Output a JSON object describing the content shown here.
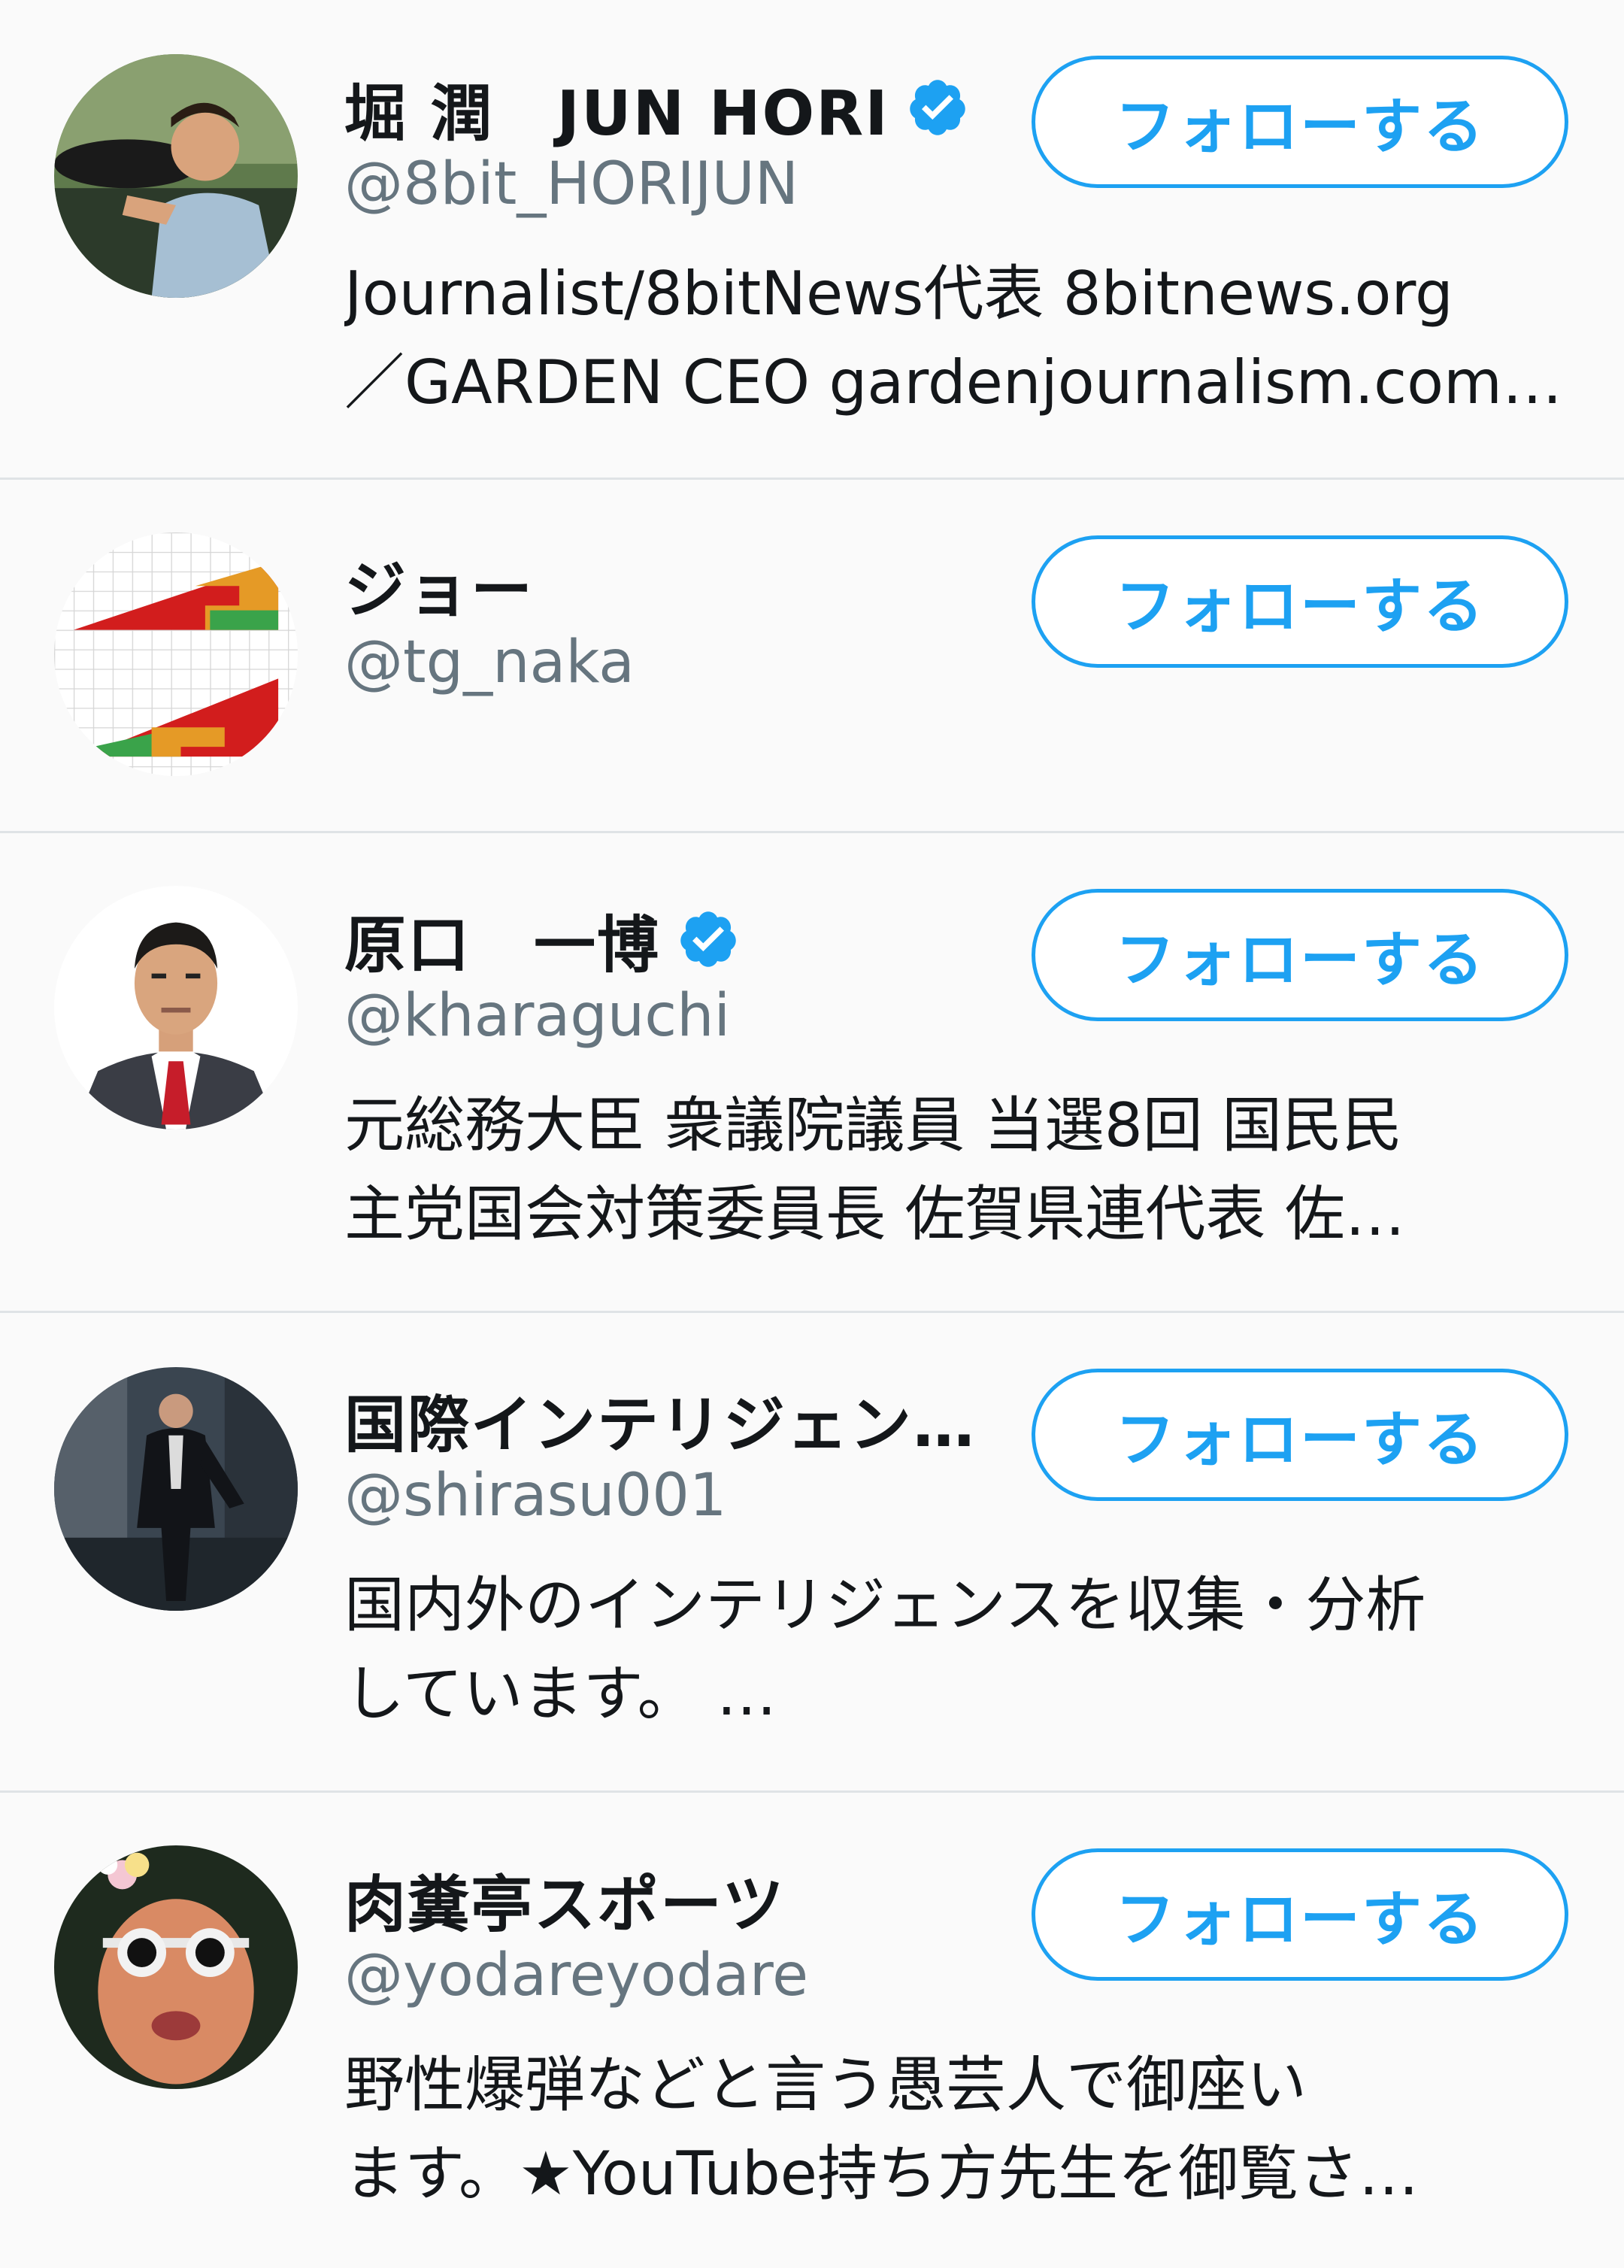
{
  "accent_color": "#1da1f2",
  "users": [
    {
      "name": "堀 潤　JUN HORI",
      "verified": true,
      "handle": "@8bit_HORIJUN",
      "bio_lines": [
        "Journalist/8bitNews代表 8bitnews.org",
        "／GARDEN CEO gardenjournalism.com…"
      ],
      "follow_label": "フォローする"
    },
    {
      "name": "ジョー",
      "verified": false,
      "handle": "@tg_naka",
      "bio_lines": [],
      "follow_label": "フォローする"
    },
    {
      "name": "原口　一博",
      "verified": true,
      "handle": "@kharaguchi",
      "bio_lines": [
        "元総務大臣 衆議院議員 当選8回 国民民",
        "主党国会対策委員長 佐賀県連代表 佐…"
      ],
      "follow_label": "フォローする"
    },
    {
      "name": "国際インテリジェン…",
      "verified": false,
      "handle": "@shirasu001",
      "bio_lines": [
        "国内外のインテリジェンスを収集・分析",
        "しています。 …"
      ],
      "follow_label": "フォローする"
    },
    {
      "name": "肉糞亭スポーツ",
      "verified": false,
      "handle": "@yodareyodare",
      "bio_lines": [
        "野性爆弾などと言う愚芸人で御座い",
        "ます。★YouTube持ち方先生を御覧さ…"
      ],
      "follow_label": "フォローする"
    }
  ]
}
